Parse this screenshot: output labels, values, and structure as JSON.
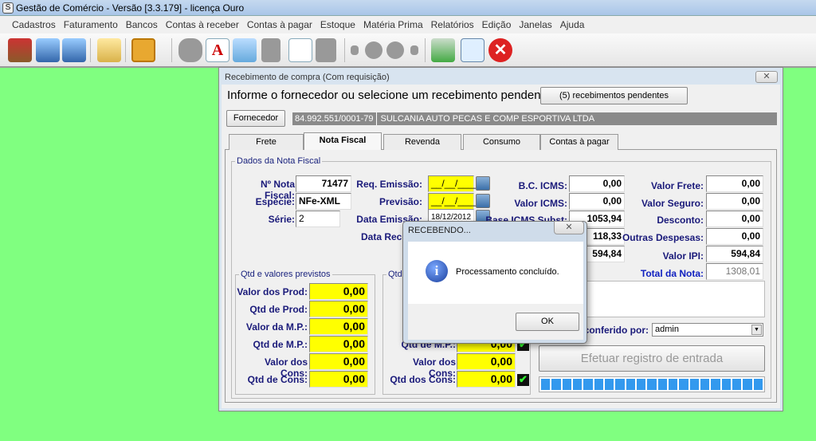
{
  "app": {
    "title": "Gestão de Comércio - Versão [3.3.179] - licença Ouro",
    "icon": "app-s-icon"
  },
  "menu": [
    "Cadastros",
    "Faturamento",
    "Bancos",
    "Contas à receber",
    "Contas à pagar",
    "Estoque",
    "Matéria Prima",
    "Relatórios",
    "Edição",
    "Janelas",
    "Ajuda"
  ],
  "toolbar": {
    "icons": [
      "box-icon",
      "computer-tools-icon",
      "computer-money-icon",
      "folder-icon",
      "key-icon",
      "hand-icon",
      "document-a-icon",
      "recycle-icon",
      "blank-doc-icon",
      "edit-doc-icon",
      "doc-corner-icon",
      "first-icon",
      "prev-icon",
      "next-icon",
      "last-icon",
      "chart-money-icon",
      "search-doc-icon",
      "close-red-icon"
    ]
  },
  "window": {
    "title": "Recebimento de compra (Com requisição)",
    "close": "✕",
    "prompt": "Informe o fornecedor ou selecione um recebimento pendente:",
    "pending_button": "(5) recebimentos pendentes",
    "supplier_button": "Fornecedor",
    "supplier_cnpj": "84.992.551/0001-79",
    "supplier_name": "SULCANIA AUTO PECAS E COMP ESPORTIVA LTDA",
    "tabs": [
      "Frete",
      "Nota Fiscal",
      "Revenda",
      "Consumo",
      "Contas à pagar"
    ],
    "active_tab": "Nota Fiscal"
  },
  "nota": {
    "legend": "Dados da Nota Fiscal",
    "numero_label": "Nº Nota Fiscal:",
    "numero": "71477",
    "especie_label": "Espécie:",
    "especie": "NFe-XML",
    "serie_label": "Série:",
    "serie": "2",
    "req_emissao_label": "Req. Emissão:",
    "req_emissao": "__/__/____",
    "previsao_label": "Previsão:",
    "previsao": "__/__/____",
    "data_emissao_label": "Data Emissão:",
    "data_emissao": "18/12/2012",
    "data_receb_label": "Data Rece",
    "bc_icms_label": "B.C. ICMS:",
    "bc_icms": "0,00",
    "valor_icms_label": "Valor ICMS:",
    "valor_icms": "0,00",
    "base_subst_label": "Base ICMS Subst:",
    "base_subst": "1053,94",
    "valor_subst": "118,33",
    "valor_prod": "594,84",
    "frete_label": "Valor Frete:",
    "frete": "0,00",
    "seguro_label": "Valor Seguro:",
    "seguro": "0,00",
    "desconto_label": "Desconto:",
    "desconto": "0,00",
    "outras_label": "Outras Despesas:",
    "outras": "0,00",
    "ipi_label": "Valor IPI:",
    "ipi": "594,84",
    "total_label": "Total da Nota:",
    "total": "1308,01"
  },
  "previstos": {
    "legend": "Qtd e valores previstos",
    "rows": [
      {
        "label": "Valor dos Prod:",
        "value": "0,00"
      },
      {
        "label": "Qtd de Prod:",
        "value": "0,00"
      },
      {
        "label": "Valor da M.P.:",
        "value": "0,00"
      },
      {
        "label": "Qtd de M.P.:",
        "value": "0,00"
      },
      {
        "label": "Valor dos Cons:",
        "value": "0,00"
      },
      {
        "label": "Qtd de Cons:",
        "value": "0,00"
      }
    ]
  },
  "recebidos": {
    "legend": "Qtd",
    "rows": [
      {
        "label": "Va",
        "value": ""
      },
      {
        "label": "",
        "value": ""
      },
      {
        "label": "V",
        "value": ""
      },
      {
        "label": "Qtd de M.P.:",
        "value": "0,00"
      },
      {
        "label": "Valor dos Cons:",
        "value": "0,00"
      },
      {
        "label": "Qtd dos Cons:",
        "value": "0,00"
      }
    ]
  },
  "conferido": {
    "label": "conferido por:",
    "value": "admin"
  },
  "register_button": "Efetuar registro de entrada",
  "progress": {
    "percent": 100,
    "color": "#3399ee"
  },
  "dialog": {
    "title": "RECEBENDO...",
    "message": "Processamento concluído.",
    "ok": "OK",
    "close": "✕",
    "icon": "info-icon"
  },
  "colors": {
    "desktop": "#80ff80",
    "highlight": "#ffff00",
    "label": "#1a1a7a"
  }
}
